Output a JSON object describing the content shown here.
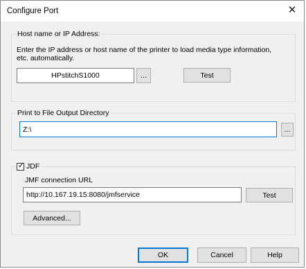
{
  "dialog": {
    "title": "Configure Port",
    "close_glyph": "✕"
  },
  "host_group": {
    "legend": "Host name or IP Address:",
    "description_line1": "Enter the IP address or host name of the printer to load media type information,",
    "description_line2": "etc. automatically.",
    "host_value": "HPstitchS1000",
    "browse_label": "...",
    "test_label": "Test"
  },
  "output_group": {
    "legend": "Print to File Output Directory",
    "path_value": "Z:\\",
    "browse_label": "..."
  },
  "jdf_group": {
    "checkbox_label": "JDF",
    "checked": true,
    "check_glyph": "✓",
    "url_label": "JMF connection URL",
    "url_value": "http://10.167.19.15:8080/jmfservice",
    "test_label": "Test",
    "advanced_label": "Advanced..."
  },
  "footer": {
    "ok_label": "OK",
    "cancel_label": "Cancel",
    "help_label": "Help"
  }
}
